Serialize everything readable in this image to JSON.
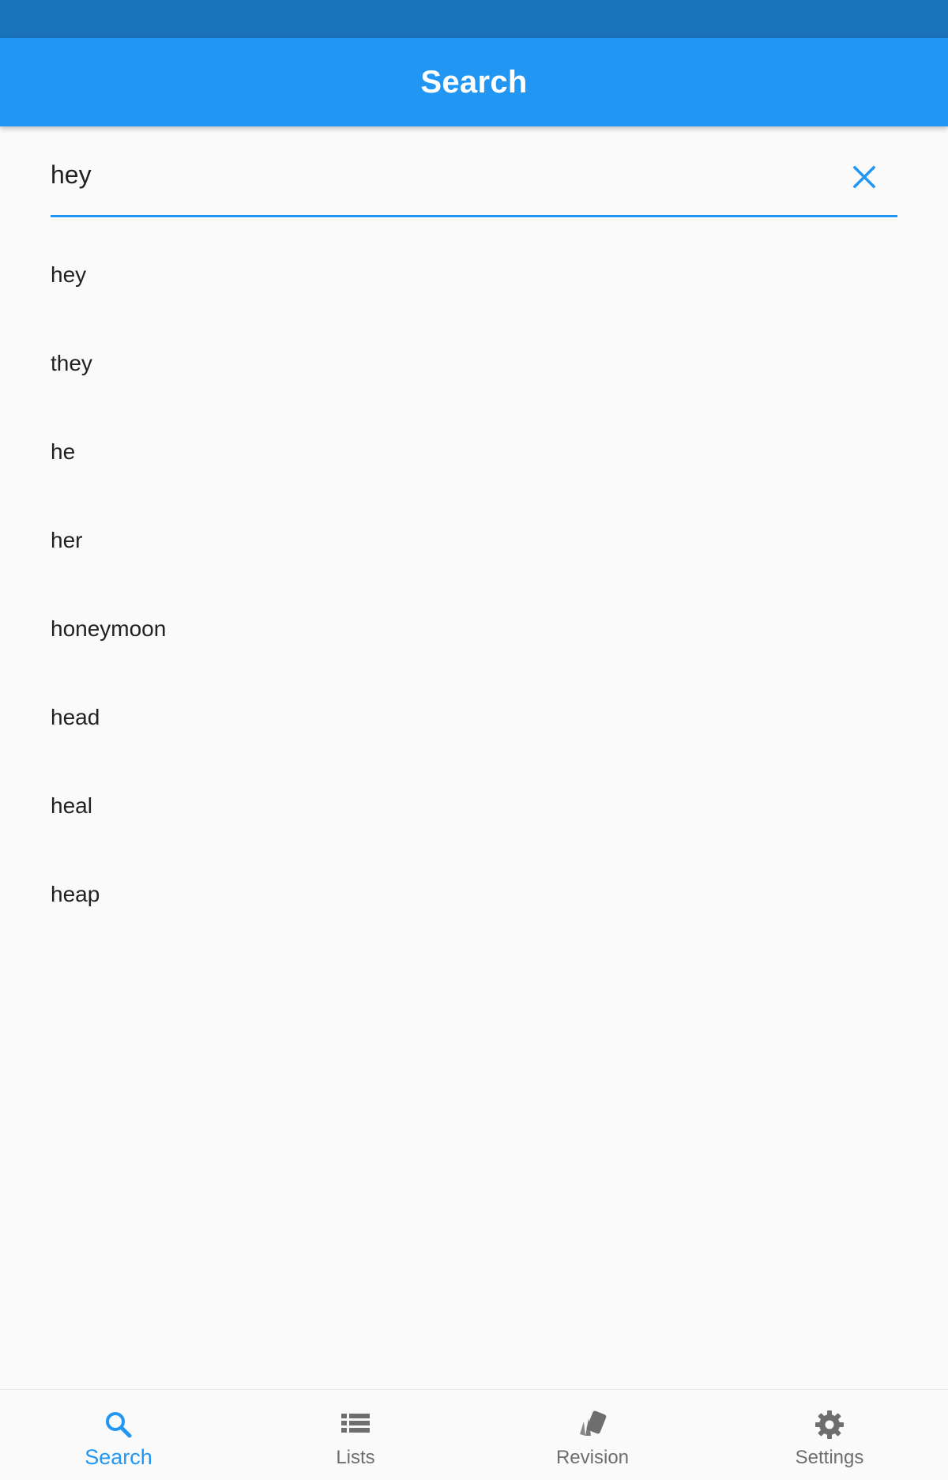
{
  "app_bar": {
    "title": "Search"
  },
  "search": {
    "value": "hey",
    "placeholder": ""
  },
  "results": [
    {
      "word": "hey"
    },
    {
      "word": "they"
    },
    {
      "word": "he"
    },
    {
      "word": "her"
    },
    {
      "word": "honeymoon"
    },
    {
      "word": "head"
    },
    {
      "word": "heal"
    },
    {
      "word": "heap"
    }
  ],
  "bottom_nav": {
    "items": [
      {
        "label": "Search",
        "icon": "search-icon",
        "active": true
      },
      {
        "label": "Lists",
        "icon": "list-icon",
        "active": false
      },
      {
        "label": "Revision",
        "icon": "cards-icon",
        "active": false
      },
      {
        "label": "Settings",
        "icon": "gear-icon",
        "active": false
      }
    ]
  },
  "colors": {
    "primary": "#2196f3",
    "status_bar": "#1a73bb",
    "inactive": "#6e6e6e",
    "background": "#fafafa"
  }
}
